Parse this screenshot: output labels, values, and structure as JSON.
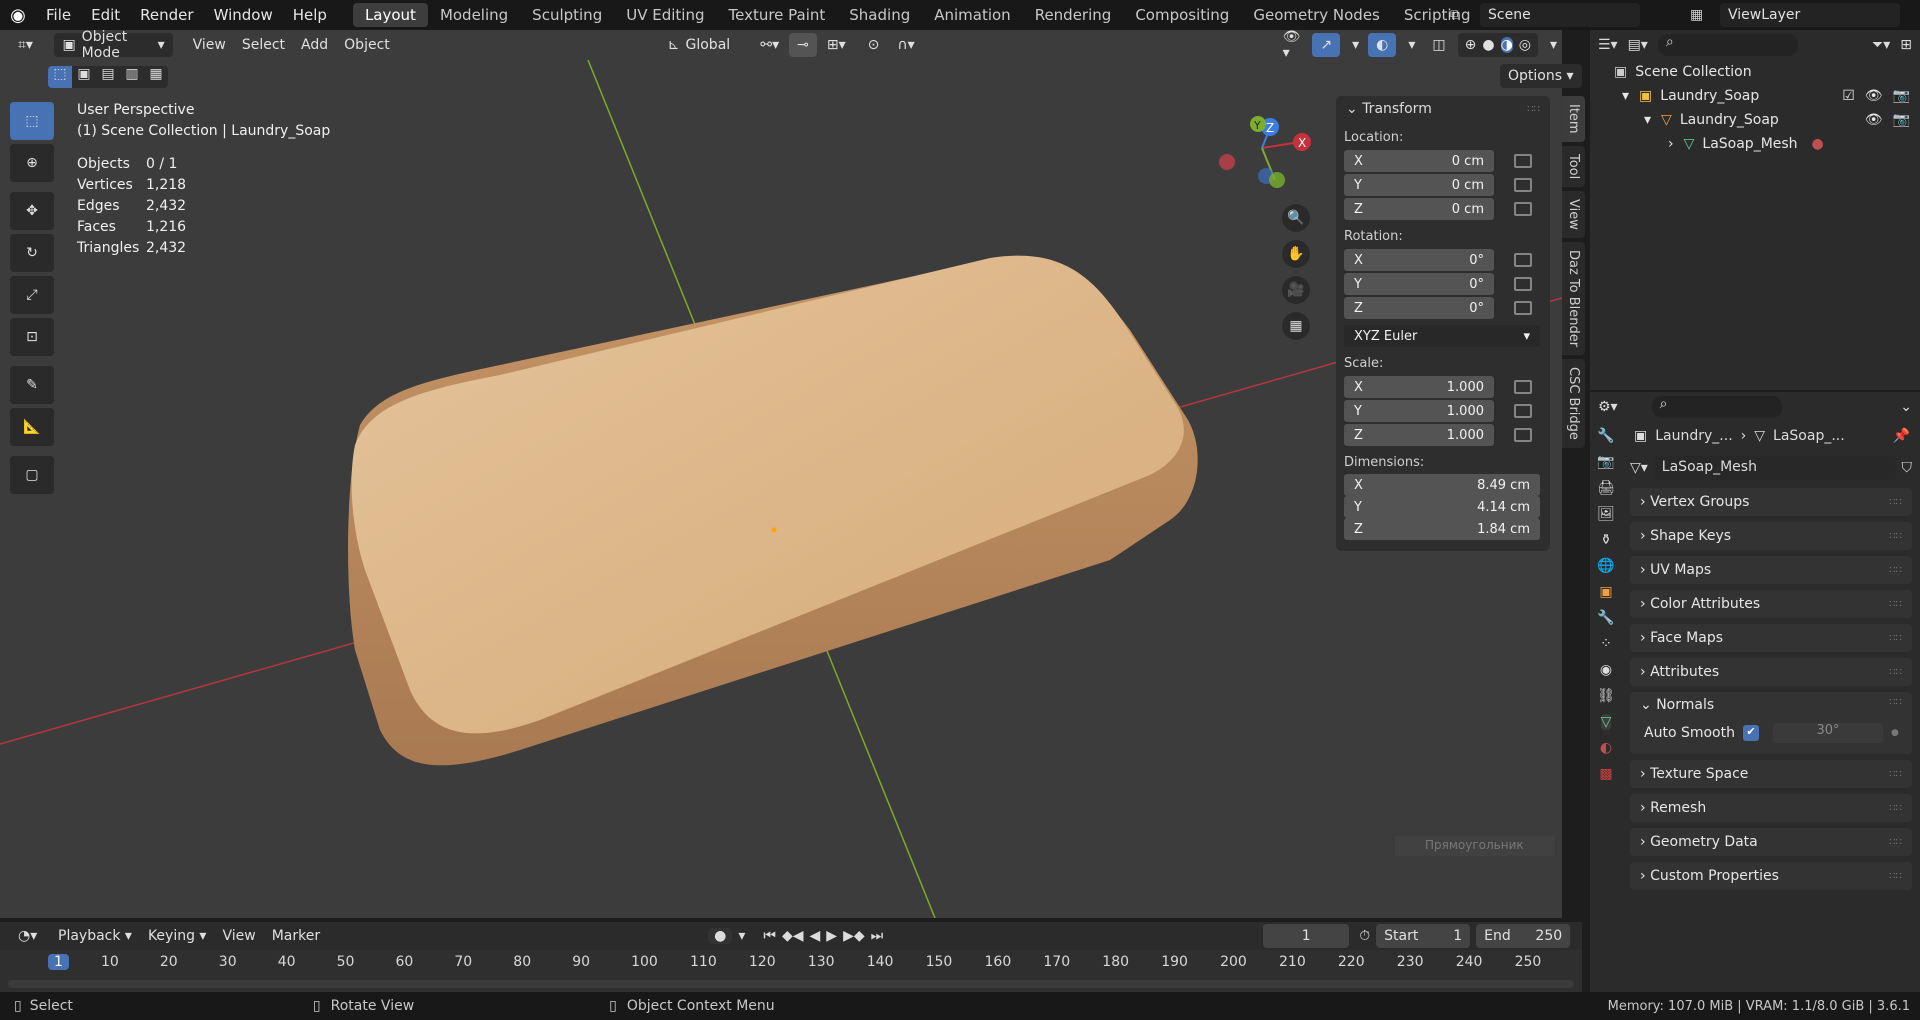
{
  "topbar": {
    "menus": [
      "File",
      "Edit",
      "Render",
      "Window",
      "Help"
    ],
    "workspaces": [
      "Layout",
      "Modeling",
      "Sculpting",
      "UV Editing",
      "Texture Paint",
      "Shading",
      "Animation",
      "Rendering",
      "Compositing",
      "Geometry Nodes",
      "Scripting"
    ],
    "active_workspace": "Layout",
    "scene": "Scene",
    "view_layer": "ViewLayer"
  },
  "viewport": {
    "mode": "Object Mode",
    "menus": [
      "View",
      "Select",
      "Add",
      "Object"
    ],
    "orientation": "Global",
    "options": "Options",
    "title": "User Perspective",
    "collection_path": "(1) Scene Collection | Laundry_Soap",
    "stats": [
      {
        "label": "Objects",
        "value": "0 / 1"
      },
      {
        "label": "Vertices",
        "value": "1,218"
      },
      {
        "label": "Edges",
        "value": "2,432"
      },
      {
        "label": "Faces",
        "value": "1,216"
      },
      {
        "label": "Triangles",
        "value": "2,432"
      }
    ],
    "ghost_text": "Прямоугольник"
  },
  "npanel": {
    "header": "Transform",
    "location_label": "Location:",
    "location": [
      {
        "axis": "X",
        "value": "0 cm"
      },
      {
        "axis": "Y",
        "value": "0 cm"
      },
      {
        "axis": "Z",
        "value": "0 cm"
      }
    ],
    "rotation_label": "Rotation:",
    "rotation": [
      {
        "axis": "X",
        "value": "0°"
      },
      {
        "axis": "Y",
        "value": "0°"
      },
      {
        "axis": "Z",
        "value": "0°"
      }
    ],
    "rotation_mode": "XYZ Euler",
    "scale_label": "Scale:",
    "scale": [
      {
        "axis": "X",
        "value": "1.000"
      },
      {
        "axis": "Y",
        "value": "1.000"
      },
      {
        "axis": "Z",
        "value": "1.000"
      }
    ],
    "dimensions_label": "Dimensions:",
    "dimensions": [
      {
        "axis": "X",
        "value": "8.49 cm"
      },
      {
        "axis": "Y",
        "value": "4.14 cm"
      },
      {
        "axis": "Z",
        "value": "1.84 cm"
      }
    ],
    "tabs": [
      "Item",
      "Tool",
      "View",
      "Daz To Blender",
      "CSC Bridge"
    ]
  },
  "outliner": {
    "root": "Scene Collection",
    "collection": "Laundry_Soap",
    "object": "Laundry_Soap",
    "mesh": "LaSoap_Mesh"
  },
  "properties": {
    "breadcrumb_obj": "Laundry_...",
    "breadcrumb_mesh": "LaSoap_...",
    "mesh_name": "LaSoap_Mesh",
    "sections": [
      "Vertex Groups",
      "Shape Keys",
      "UV Maps",
      "Color Attributes",
      "Face Maps",
      "Attributes",
      "Normals"
    ],
    "auto_smooth_label": "Auto Smooth",
    "auto_smooth_angle": "30°",
    "sections_after": [
      "Texture Space",
      "Remesh",
      "Geometry Data",
      "Custom Properties"
    ]
  },
  "timeline": {
    "menus": [
      "Playback",
      "Keying",
      "View",
      "Marker"
    ],
    "current_frame": "1",
    "start_label": "Start",
    "start": "1",
    "end_label": "End",
    "end": "250",
    "ticks": [
      "1",
      "10",
      "20",
      "30",
      "40",
      "50",
      "60",
      "70",
      "80",
      "90",
      "100",
      "110",
      "120",
      "130",
      "140",
      "150",
      "160",
      "170",
      "180",
      "190",
      "200",
      "210",
      "220",
      "230",
      "240",
      "250"
    ]
  },
  "status": {
    "select": "Select",
    "rotate": "Rotate View",
    "context": "Object Context Menu",
    "memory": "Memory: 107.0 MiB | VRAM: 1.1/8.0 GiB | 3.6.1"
  },
  "colors": {
    "accent": "#4772b3",
    "bg_viewport": "#3c3c3c",
    "x_axis": "#c8303c",
    "y_axis": "#7cae2c",
    "z_axis": "#3c7ee0"
  }
}
